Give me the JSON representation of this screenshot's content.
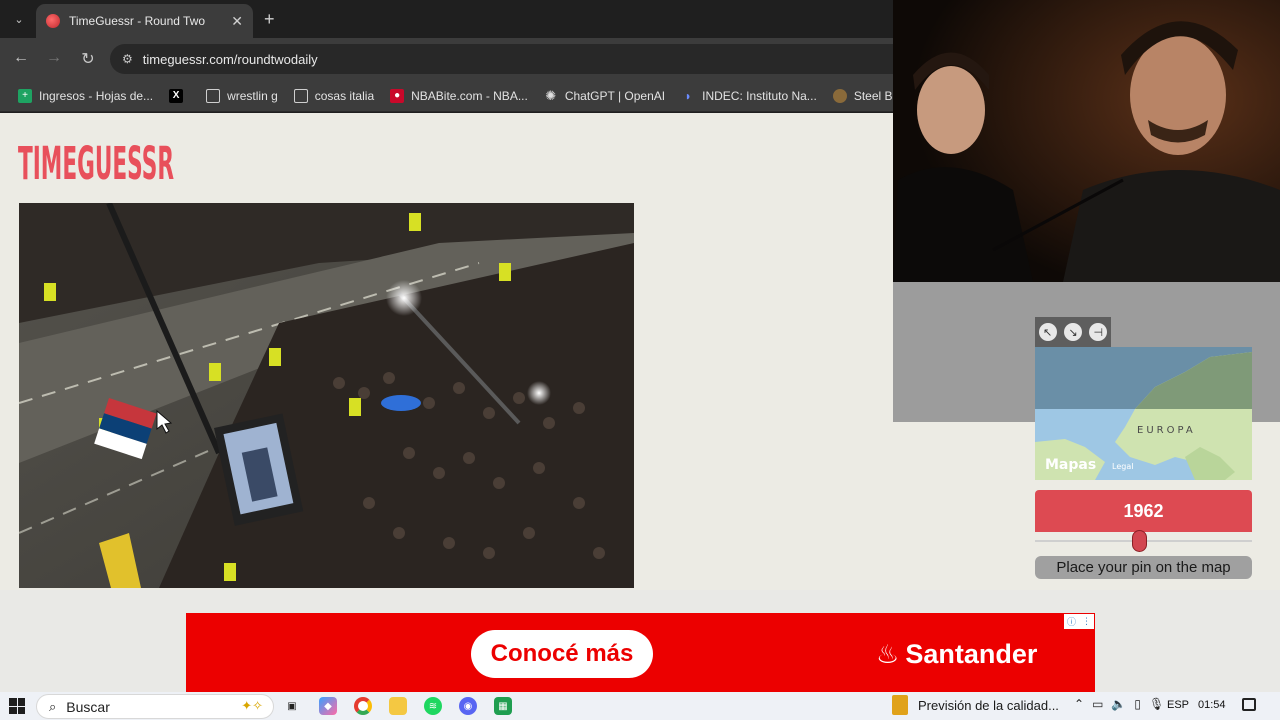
{
  "browser": {
    "tab_title": "TimeGuessr - Round Two",
    "tab_close": "✕",
    "new_tab": "+",
    "url": "timeguessr.com/roundtwodaily",
    "bookmarks": [
      {
        "label": "Ingresos - Hojas de...",
        "icon": "sheets-icon",
        "color": "#1ea362"
      },
      {
        "label": "",
        "icon": "x-logo-icon",
        "color": "#000000"
      },
      {
        "label": "wrestlin g",
        "icon": "folder-icon",
        "color": "#3c3c3c"
      },
      {
        "label": "cosas italia",
        "icon": "folder-icon",
        "color": "#3c3c3c"
      },
      {
        "label": "NBABite.com - NBA...",
        "icon": "nba-icon",
        "color": "#c9082a"
      },
      {
        "label": "ChatGPT | OpenAI",
        "icon": "openai-icon",
        "color": "#3c3c3c"
      },
      {
        "label": "INDEC: Instituto Na...",
        "icon": "indec-icon",
        "color": "#2a5ab8"
      },
      {
        "label": "Steel Ball Run Man",
        "icon": "sbr-icon",
        "color": "#8a6a3a"
      }
    ]
  },
  "page": {
    "logo_text": "TIMEGUESSR",
    "year": "1962",
    "slider_value_fraction": 0.48,
    "pin_button": "Place your pin on the map",
    "map": {
      "region_label": "EUROPA",
      "attribution": "Mapas",
      "legal": "Legal"
    }
  },
  "ad": {
    "cta": "Conocé más",
    "brand": "Santander"
  },
  "taskbar": {
    "search_placeholder": "Buscar",
    "weather_text": "Previsión de la calidad...",
    "language": "ESP",
    "time": "01:54"
  },
  "colors": {
    "accent_red": "#dd4a52",
    "page_bg": "#ecebe4",
    "ad_red": "#ec0000"
  }
}
